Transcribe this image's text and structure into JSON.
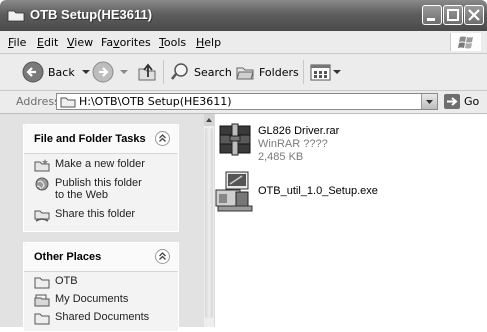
{
  "window": {
    "title": "OTB Setup(HE3611)"
  },
  "menu": {
    "items": [
      {
        "label": "File",
        "accel": "F",
        "rest": "ile"
      },
      {
        "label": "Edit",
        "accel": "E",
        "rest": "dit"
      },
      {
        "label": "View",
        "accel": "V",
        "rest": "iew"
      },
      {
        "label": "Favorites",
        "accel": "",
        "rest": "Fa",
        "accel2": "v",
        "rest2": "orites"
      },
      {
        "label": "Tools",
        "accel": "T",
        "rest": "ools"
      },
      {
        "label": "Help",
        "accel": "H",
        "rest": "elp"
      }
    ]
  },
  "toolbar": {
    "back_label": "Back",
    "search_label": "Search",
    "folders_label": "Folders"
  },
  "address": {
    "label": "Address",
    "path": "H:\\OTB\\OTB Setup(HE3611)",
    "go_label": "Go"
  },
  "tasks_panel": {
    "title": "File and Folder Tasks",
    "items": [
      {
        "label": "Make a new folder",
        "icon": "new-folder-icon"
      },
      {
        "label": "Publish this folder to the Web",
        "icon": "globe-icon"
      },
      {
        "label": "Share this folder",
        "icon": "share-folder-icon"
      }
    ]
  },
  "places_panel": {
    "title": "Other Places",
    "items": [
      {
        "label": "OTB",
        "icon": "folder-icon"
      },
      {
        "label": "My Documents",
        "icon": "documents-icon"
      },
      {
        "label": "Shared Documents",
        "icon": "folder-icon"
      }
    ]
  },
  "files": [
    {
      "name": "GL826 Driver.rar",
      "type": "WinRAR ????",
      "size": "2,485 KB",
      "icon": "winrar-archive-icon"
    },
    {
      "name": "OTB_util_1.0_Setup.exe",
      "icon": "setup-installer-icon"
    }
  ],
  "colors": {
    "titlebar": "#5e5e5e",
    "pane": "#e2e2e2",
    "panel": "#f3f3f3"
  }
}
